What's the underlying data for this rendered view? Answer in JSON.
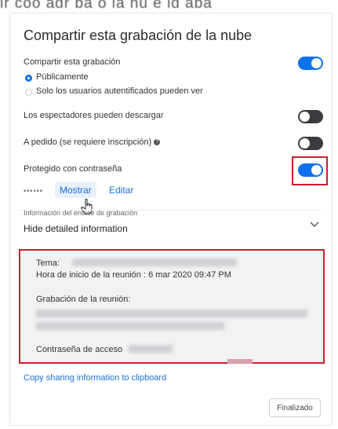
{
  "top_partial_text": "ir coo agr ba o ia nu e ig aba",
  "dialog": {
    "title": "Compartir esta grabación de la nube",
    "share_label": "Compartir esta grabación",
    "share_on": true,
    "radio_public": "Públicamente",
    "radio_auth": "Solo los usuarios autentificados pueden ver",
    "radio_selected": "public",
    "download_label": "Los espectadores pueden descargar",
    "download_on": false,
    "ondemand_label": "A pedido (se requiere inscripción)",
    "ondemand_on": false,
    "password_label": "Protegido con contraseña",
    "password_on": true,
    "password_mask": "••••••",
    "show_button": "Mostrar",
    "edit_button": "Editar",
    "link_info_label": "Información del enlace de grabación",
    "hide_details": "Hide detailed information",
    "info": {
      "topic_label": "Tema:",
      "start_time": "Hora de inicio de la reunión : 6 mar 2020 09:47 PM",
      "recording_label": "Grabación de la reunión:",
      "access_password_label": "Contraseña de acceso"
    },
    "copy_link": "Copy sharing information to clipboard",
    "done_button": "Finalizado"
  },
  "colors": {
    "accent": "#0e72ed",
    "highlight_red": "#c8202a",
    "toggle_off": "#3b3b40"
  }
}
